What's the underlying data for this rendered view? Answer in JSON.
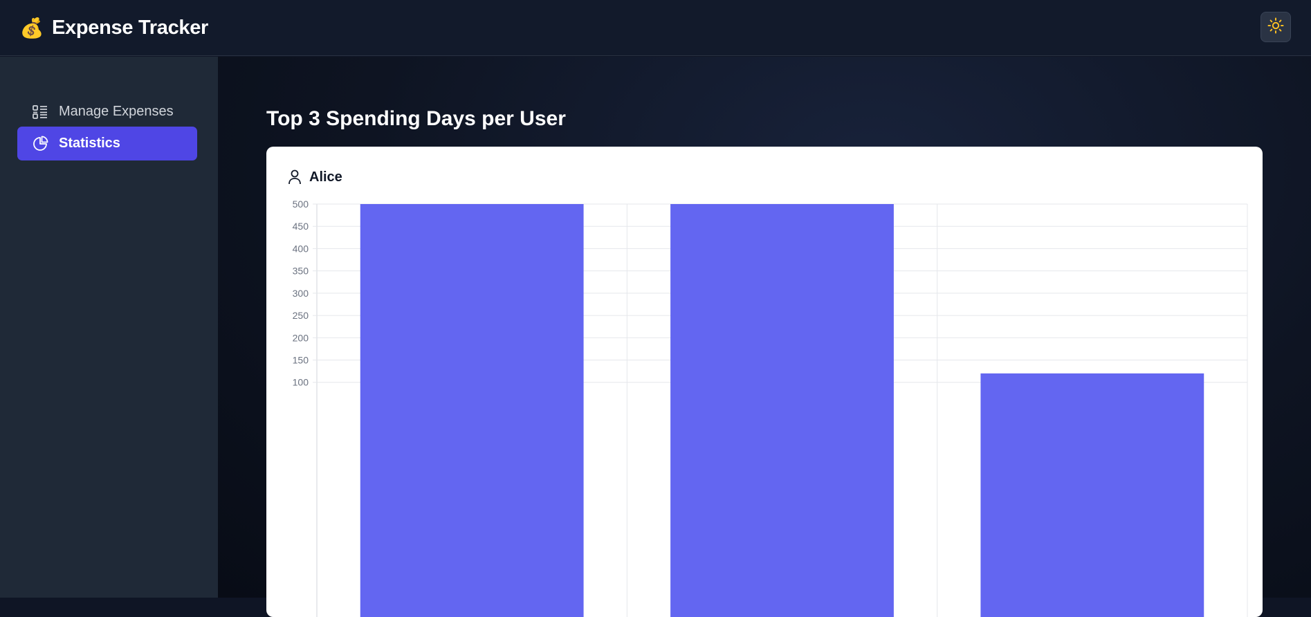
{
  "app": {
    "title": "Expense Tracker",
    "brand_icon": "money-bag-icon"
  },
  "header": {
    "theme_toggle_icon": "sun-icon"
  },
  "sidebar": {
    "items": [
      {
        "label": "Manage Expenses",
        "icon": "list-icon",
        "active": false
      },
      {
        "label": "Statistics",
        "icon": "pie-chart-icon",
        "active": true
      }
    ]
  },
  "main": {
    "title": "Top 3 Spending Days per User",
    "cards": [
      {
        "user": "Alice",
        "icon": "user-icon"
      }
    ]
  },
  "colors": {
    "accent": "#4f46e5",
    "bar": "#6366f1",
    "header_bg": "#121a2b",
    "sidebar_bg": "#1f2937",
    "sun": "#fbbf24"
  },
  "chart_data": {
    "type": "bar",
    "categories": [
      "",
      "",
      ""
    ],
    "series": [
      {
        "values": [
          500,
          500,
          120
        ]
      }
    ],
    "yticks": [
      100,
      150,
      200,
      250,
      300,
      350,
      400,
      450,
      500
    ],
    "ylim": [
      60,
      500
    ],
    "grid": true
  }
}
